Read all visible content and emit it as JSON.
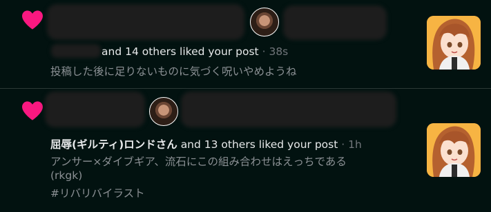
{
  "notifications": [
    {
      "actor": "",
      "others_text": "and 14 others liked your post",
      "separator": "·",
      "time": "38s",
      "post_lines": [
        "投稿した後に足りないものに気づく呪いやめようね"
      ]
    },
    {
      "actor": "屈辱(ギルティ)ロンドさん",
      "others_text": "and 13 others liked your post",
      "separator": "·",
      "time": "1h",
      "post_lines": [
        "アンサー×ダイブギア、流石にこの組み合わせはえっちである",
        "(rkgk)",
        "#リバリバイラスト"
      ]
    }
  ],
  "colors": {
    "background": "#021210",
    "heart": "#f91880",
    "divider": "#2c3a37",
    "muted": "#71767b"
  },
  "icons": {
    "like": "heart-icon"
  }
}
